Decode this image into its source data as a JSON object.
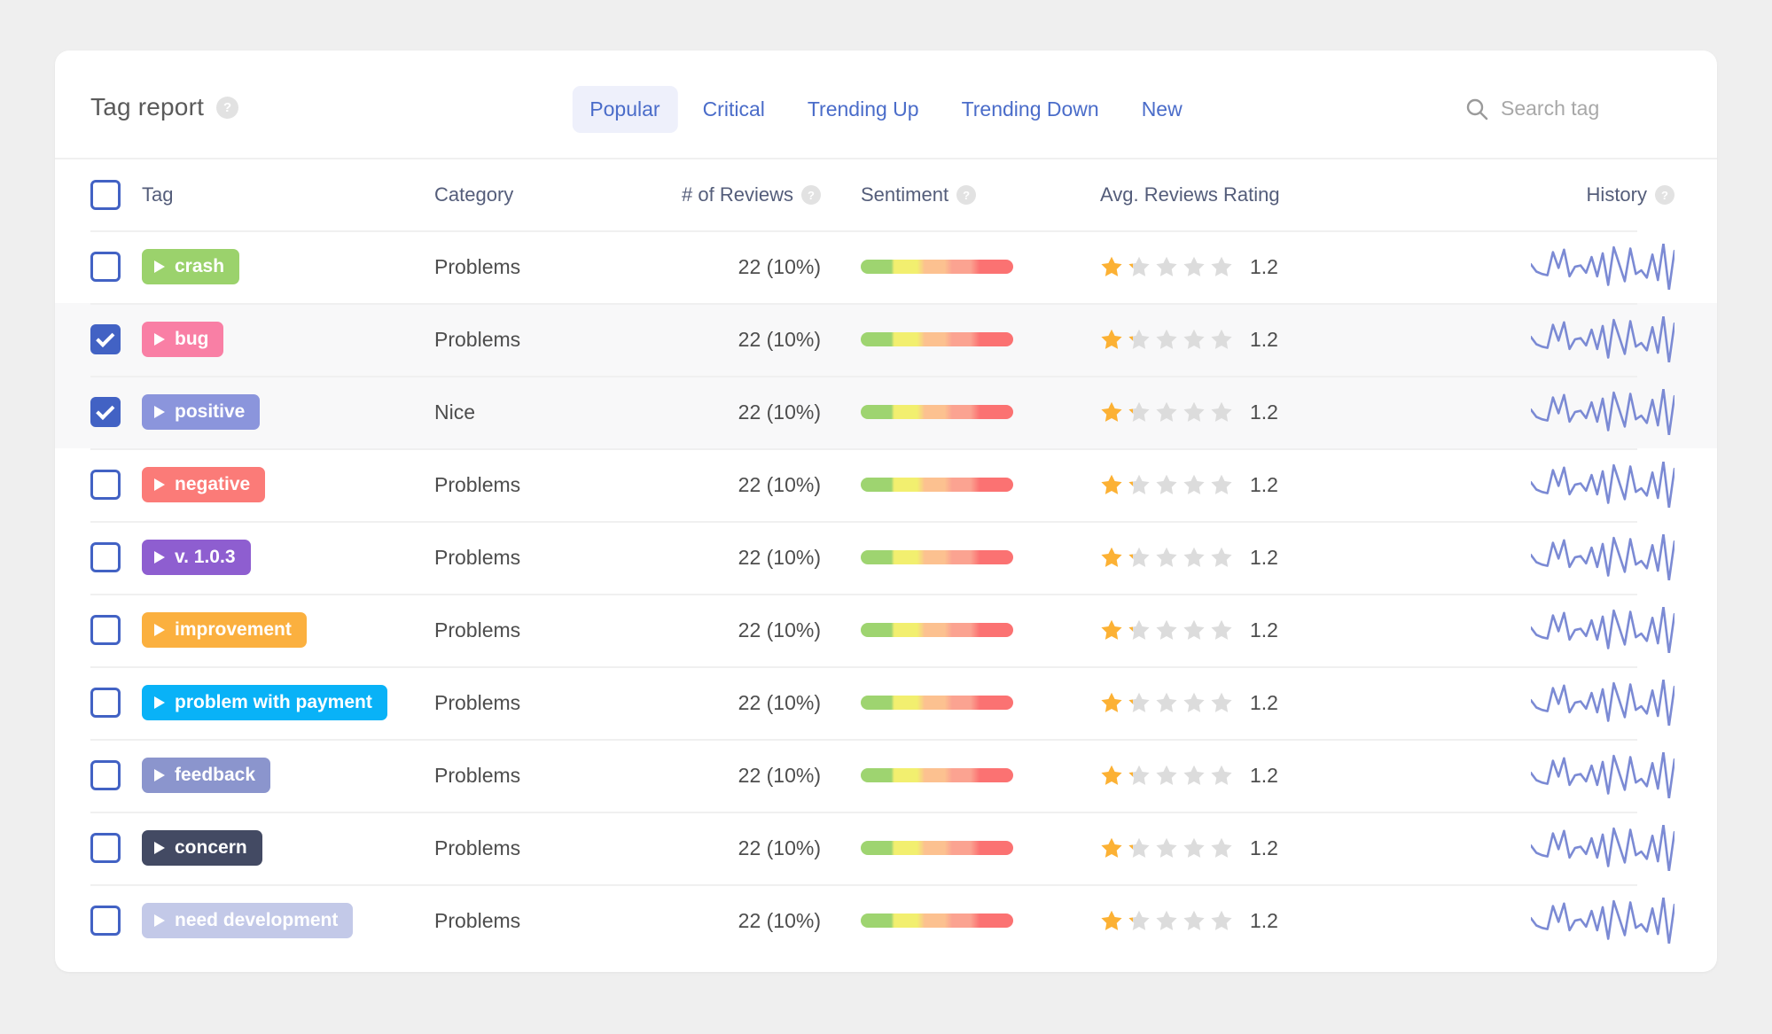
{
  "header": {
    "title": "Tag report",
    "help_icon": "question-mark-icon",
    "tabs": [
      {
        "label": "Popular",
        "active": true
      },
      {
        "label": "Critical",
        "active": false
      },
      {
        "label": "Trending Up",
        "active": false
      },
      {
        "label": "Trending Down",
        "active": false
      },
      {
        "label": "New",
        "active": false
      }
    ],
    "search": {
      "icon": "search-icon",
      "placeholder": "Search tag",
      "value": ""
    }
  },
  "colors": {
    "page_background": "#efefef",
    "card_background": "#ffffff",
    "tab_accent": "#4a6cc9",
    "tab_active_background": "#eef0fb",
    "checkbox_accent": "#4262c4",
    "header_text": "#545d7a",
    "selected_row_background": "#f8f8f9",
    "star_filled": "#fcb134",
    "star_empty": "#dcdcdc",
    "sparkline": "#7b8ad4"
  },
  "table": {
    "select_all_checked": false,
    "columns": [
      {
        "key": "tag",
        "label": "Tag",
        "help": false
      },
      {
        "key": "category",
        "label": "Category",
        "help": false
      },
      {
        "key": "reviews",
        "label": "# of Reviews",
        "help": true
      },
      {
        "key": "sentiment",
        "label": "Sentiment",
        "help": true
      },
      {
        "key": "rating",
        "label": "Avg. Reviews Rating",
        "help": false
      },
      {
        "key": "history",
        "label": "History",
        "help": true
      }
    ],
    "rows": [
      {
        "checked": false,
        "tag": "crash",
        "color": "#9bd26c",
        "category": "Problems",
        "reviews": "22 (10%)",
        "rating": "1.2",
        "stars_filled": 1.2
      },
      {
        "checked": true,
        "tag": "bug",
        "color": "#f97fa5",
        "category": "Problems",
        "reviews": "22 (10%)",
        "rating": "1.2",
        "stars_filled": 1.2
      },
      {
        "checked": true,
        "tag": "positive",
        "color": "#8b95dc",
        "category": "Nice",
        "reviews": "22 (10%)",
        "rating": "1.2",
        "stars_filled": 1.2
      },
      {
        "checked": false,
        "tag": "negative",
        "color": "#fb7b78",
        "category": "Problems",
        "reviews": "22 (10%)",
        "rating": "1.2",
        "stars_filled": 1.2
      },
      {
        "checked": false,
        "tag": "v. 1.0.3",
        "color": "#8e5ed0",
        "category": "Problems",
        "reviews": "22 (10%)",
        "rating": "1.2",
        "stars_filled": 1.2
      },
      {
        "checked": false,
        "tag": "improvement",
        "color": "#fbb03f",
        "category": "Problems",
        "reviews": "22 (10%)",
        "rating": "1.2",
        "stars_filled": 1.2
      },
      {
        "checked": false,
        "tag": "problem with payment",
        "color": "#09b2f7",
        "category": "Problems",
        "reviews": "22 (10%)",
        "rating": "1.2",
        "stars_filled": 1.2
      },
      {
        "checked": false,
        "tag": "feedback",
        "color": "#8b95cd",
        "category": "Problems",
        "reviews": "22 (10%)",
        "rating": "1.2",
        "stars_filled": 1.2
      },
      {
        "checked": false,
        "tag": "concern",
        "color": "#434a63",
        "category": "Problems",
        "reviews": "22 (10%)",
        "rating": "1.2",
        "stars_filled": 1.2
      },
      {
        "checked": false,
        "tag": "need development",
        "color": "#c3c9e8",
        "category": "Problems",
        "reviews": "22 (10%)",
        "rating": "1.2",
        "stars_filled": 1.2
      }
    ]
  },
  "chart_data": {
    "type": "line",
    "title": "History sparkline",
    "xlabel": "",
    "ylabel": "",
    "grid": false,
    "legend": "none",
    "series": [
      {
        "name": "history",
        "values": [
          62,
          50,
          46,
          44,
          82,
          56,
          86,
          42,
          58,
          60,
          48,
          74,
          42,
          80,
          28,
          90,
          62,
          34,
          88,
          46,
          52,
          40,
          78,
          36,
          96,
          20,
          84
        ]
      }
    ]
  }
}
